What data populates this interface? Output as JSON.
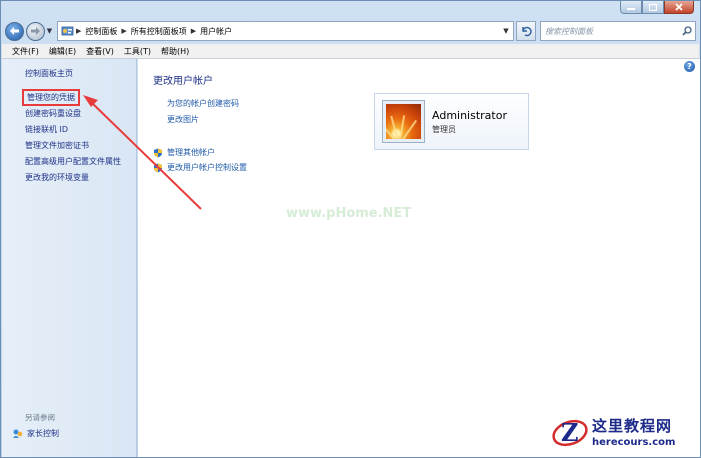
{
  "window": {
    "caption_buttons": [
      "minimize",
      "maximize",
      "close"
    ]
  },
  "address_bar": {
    "breadcrumbs": [
      "控制面板",
      "所有控制面板项",
      "用户帐户"
    ],
    "search_placeholder": "搜索控制面板",
    "icons": [
      "back-arrow-icon",
      "forward-arrow-icon",
      "control-panel-icon",
      "refresh-icon",
      "search-icon"
    ]
  },
  "menu": [
    "文件(F)",
    "编辑(E)",
    "查看(V)",
    "工具(T)",
    "帮助(H)"
  ],
  "sidebar": {
    "home": "控制面板主页",
    "items": [
      {
        "label": "管理您的凭据",
        "highlighted": true
      },
      {
        "label": "创建密码重设盘"
      },
      {
        "label": "链接联机 ID"
      },
      {
        "label": "管理文件加密证书"
      },
      {
        "label": "配置高级用户配置文件属性"
      },
      {
        "label": "更改我的环境变量"
      }
    ],
    "see_also": "另请参阅",
    "parental_control": "家长控制"
  },
  "main": {
    "title": "更改用户帐户",
    "links": [
      "为您的帐户创建密码",
      "更改图片"
    ],
    "shield_links": [
      "管理其他帐户",
      "更改用户帐户控制设置"
    ],
    "account": {
      "name": "Administrator",
      "role": "管理员"
    }
  },
  "watermark": "www.pHome.NET",
  "highlight_color": "#e83c3c",
  "brand": {
    "title": "这里教程网",
    "url": "herecours.com"
  }
}
